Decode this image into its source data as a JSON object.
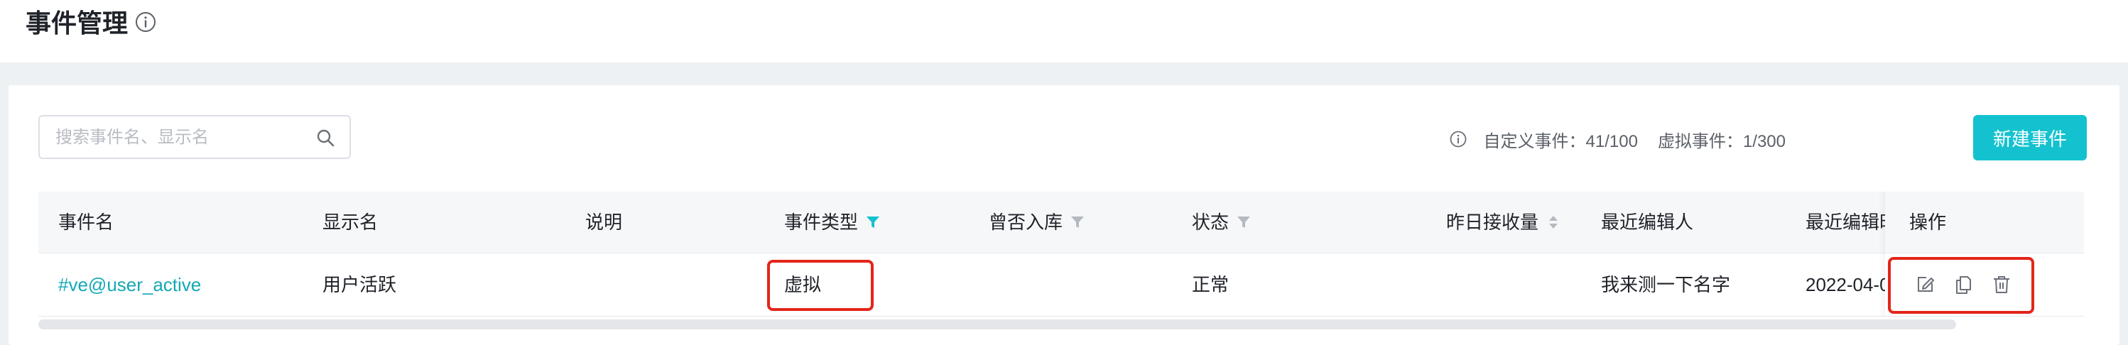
{
  "header": {
    "title": "事件管理",
    "info_icon": "info-circle-icon"
  },
  "toolbar": {
    "search_placeholder": "搜索事件名、显示名",
    "search_value": "",
    "search_icon": "search-icon",
    "custom_events_label": "自定义事件：41/100",
    "virtual_events_label": "虚拟事件：1/300",
    "new_event_button": "新建事件"
  },
  "table": {
    "columns": [
      {
        "key": "event_name",
        "label": "事件名"
      },
      {
        "key": "display_name",
        "label": "显示名"
      },
      {
        "key": "description",
        "label": "说明"
      },
      {
        "key": "event_type",
        "label": "事件类型",
        "icon": "filter-icon",
        "active": true
      },
      {
        "key": "ingested",
        "label": "曾否入库",
        "icon": "filter-icon",
        "active": false
      },
      {
        "key": "status",
        "label": "状态",
        "icon": "filter-icon",
        "active": false
      },
      {
        "key": "yesterday_received",
        "label": "昨日接收量",
        "icon": "sort-icon"
      },
      {
        "key": "last_editor",
        "label": "最近编辑人"
      },
      {
        "key": "last_edited",
        "label": "最近编辑时"
      },
      {
        "key": "actions",
        "label": "操作"
      }
    ],
    "rows": [
      {
        "event_name": "#ve@user_active",
        "display_name": "用户活跃",
        "description": "",
        "event_type": "虚拟",
        "ingested": "",
        "status": "正常",
        "yesterday_received": "",
        "last_editor": "我来测一下名字",
        "last_edited": "2022-04-0",
        "actions": [
          "edit-icon",
          "copy-icon",
          "delete-icon"
        ]
      }
    ]
  },
  "colors": {
    "accent": "#14c2cf",
    "link": "#14a8b5",
    "highlight_border": "#e3251a",
    "header_bg": "#f6f7f9",
    "page_bg": "#eef1f4"
  }
}
